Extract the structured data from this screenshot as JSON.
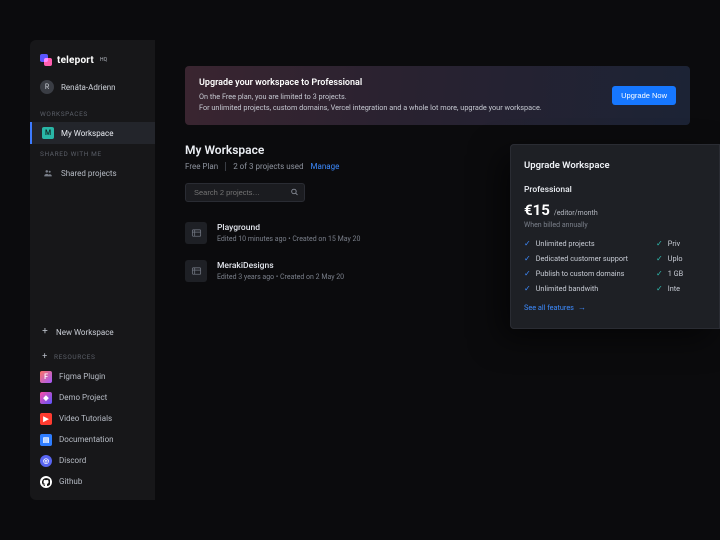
{
  "brand": {
    "name": "teleport",
    "badge": "HQ"
  },
  "user": {
    "initial": "R",
    "name": "Renáta-Adrienn"
  },
  "sidebar": {
    "workspaces_label": "WORKSPACES",
    "shared_label": "SHARED WITH ME",
    "workspace": {
      "initial": "M",
      "name": "My Workspace"
    },
    "shared_projects": "Shared projects",
    "new_workspace": "New Workspace",
    "resources_label": "RESOURCES",
    "resources": [
      {
        "key": "figma",
        "label": "Figma Plugin"
      },
      {
        "key": "demo",
        "label": "Demo Project"
      },
      {
        "key": "video",
        "label": "Video Tutorials"
      },
      {
        "key": "docs",
        "label": "Documentation"
      },
      {
        "key": "discord",
        "label": "Discord"
      },
      {
        "key": "github",
        "label": "Github"
      }
    ]
  },
  "banner": {
    "title": "Upgrade your workspace to Professional",
    "line1": "On the Free plan, you are limited to 3 projects.",
    "line2": "For unlimited projects, custom domains, Vercel integration and a whole lot more, upgrade your workspace.",
    "cta": "Upgrade Now"
  },
  "workspace": {
    "name": "My Workspace",
    "plan": "Free Plan",
    "usage": "2 of 3 projects used",
    "manage": "Manage"
  },
  "search": {
    "placeholder": "Search 2 projects…"
  },
  "projects": [
    {
      "name": "Playground",
      "meta": "Edited 10 minutes ago  •  Created on 15 May 20"
    },
    {
      "name": "MerakiDesigns",
      "meta": "Edited 3 years ago  •  Created on 2 May 20"
    }
  ],
  "upgrade_panel": {
    "title": "Upgrade Workspace",
    "plan": "Professional",
    "price": "€15",
    "price_unit": "/editor/month",
    "price_note": "When billed annually",
    "features_col1": [
      "Unlimited projects",
      "Dedicated customer support",
      "Publish to custom domains",
      "Unlimited bandwith"
    ],
    "features_col2": [
      "Priv",
      "Uplo",
      "1 GB",
      "Inte"
    ],
    "see_all": "See all features"
  }
}
